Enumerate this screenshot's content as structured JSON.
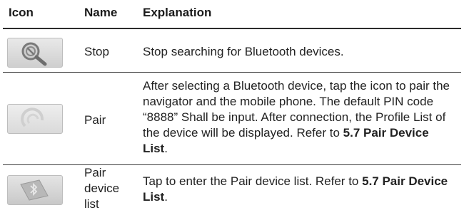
{
  "header": {
    "icon": "Icon",
    "name": "Name",
    "explanation": "Explanation"
  },
  "rows": [
    {
      "icon": "stop-search-icon",
      "name": "Stop",
      "explanation": "Stop searching for Bluetooth devices."
    },
    {
      "icon": "pair-icon",
      "name": "Pair",
      "explanation_text": "After selecting a Bluetooth device, tap the icon to pair the navigator and the mobile phone. The default PIN code “8888” Shall be input. After connection, the Profile List of the device will be displayed. Refer to ",
      "explanation_ref": "5.7 Pair Device List",
      "explanation_end": "."
    },
    {
      "icon": "bluetooth-device-list-icon",
      "name": "Pair device list",
      "explanation_text": "Tap to enter the Pair device list. Refer to ",
      "explanation_ref": "5.7 Pair Device List",
      "explanation_end": "."
    }
  ]
}
